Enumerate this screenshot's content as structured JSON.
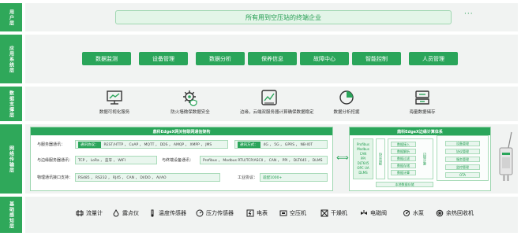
{
  "layers": {
    "user": "用户层",
    "application": "应用系统层",
    "data_support": "数据支撑层",
    "network": "网络传输层",
    "basic_sensing": "基础感知层"
  },
  "user_bar": "所有用到空压站的终端企业",
  "user_more": "···",
  "apps": [
    "数据监测",
    "设备管理",
    "数据分析",
    "保养信息",
    "故障中心",
    "智能控制",
    "人员管理"
  ],
  "services": [
    {
      "icon": "monitor-chart-icon",
      "label": "数据可视化服务"
    },
    {
      "icon": "gear-shield-icon",
      "label": "防火墙微保数据安全"
    },
    {
      "icon": "trend-chart-icon",
      "label": "边缘，云端双服务器计算确保数据稳定"
    },
    {
      "icon": "pie-chart-icon",
      "label": "数据分析挖掘"
    },
    {
      "icon": "storage-icon",
      "label": "海量数据储存"
    }
  ],
  "network": {
    "left_title": "鼎科EdgeX网关物联网通信架构",
    "rows": {
      "server_comm": "与服务器通讯：",
      "comm_protocol_tag": "通讯协议：",
      "comm_protocols": "REST/HTTP ， CoAP ， MQTT ， DDS ， AMQP ， XMPP ， JMS",
      "comm_mode_tag": "通讯方式：",
      "comm_modes": "4G ， 5G ， GPRS ， NB-IOT",
      "edge_server": "与边缘服务器通讯：",
      "edge_protocols": "TCP ， LoRa ， 蓝牙 ， WIFI",
      "terminal": "与终端设备通讯：",
      "terminal_protocols": "Profibus ， Modbus RTU/TCP/ASCII ， CAN ， PPI ， DLT645 ， DLMS",
      "physical_if": "物理通讯接口支持：",
      "physical_values": "RS485 ， RS232 ， RJ45 ， CAN ， DI/DO ， AI/AO",
      "industrial": "工业协议：",
      "industrial_value": "适配1000+"
    },
    "arrow": "⟺",
    "right_title": "鼎科EdgeX边缘计算体系",
    "protocols": [
      "Profibus",
      "Modbus",
      "CAN",
      "PPI",
      "DLT645",
      "OPC UA",
      "DLMS"
    ],
    "protocol_adapt": "协议适配",
    "data_items": [
      "数据接入",
      "数据解析",
      "数据过滤",
      "数据存储",
      "数据计算"
    ],
    "edge_mid": "边缘计算",
    "manage_items": [
      "设备管理",
      "协议管理",
      "服务管理",
      "监控管理",
      "OTA"
    ],
    "bottom_bar": "本地数据存储"
  },
  "devices": [
    {
      "icon": "flow-meter-icon",
      "label": "流量计"
    },
    {
      "icon": "dew-point-icon",
      "label": "露点仪"
    },
    {
      "icon": "temperature-icon",
      "label": "温度传感器"
    },
    {
      "icon": "pressure-icon",
      "label": "压力传感器"
    },
    {
      "icon": "electric-meter-icon",
      "label": "电表"
    },
    {
      "icon": "compressor-icon",
      "label": "空压机"
    },
    {
      "icon": "dryer-icon",
      "label": "干燥机"
    },
    {
      "icon": "solenoid-valve-icon",
      "label": "电磁阀"
    },
    {
      "icon": "pump-icon",
      "label": "水泵"
    },
    {
      "icon": "heat-recovery-icon",
      "label": "余热回收机"
    }
  ],
  "colors": {
    "accent": "#2aa55a",
    "light": "#e3f5e8",
    "panel": "#f1f3f2"
  }
}
